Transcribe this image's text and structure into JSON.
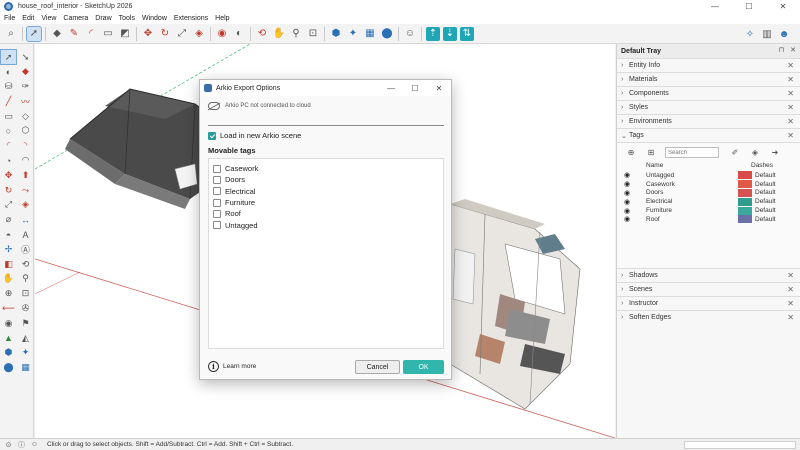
{
  "window": {
    "title": "house_roof_interior - SketchUp 2026"
  },
  "menu": [
    "File",
    "Edit",
    "View",
    "Camera",
    "Draw",
    "Tools",
    "Window",
    "Extensions",
    "Help"
  ],
  "dialog": {
    "title": "Arkio Export Options",
    "cloud_status": "Arkio PC not connected to cloud",
    "load_label": "Load in new Arkio scene",
    "load_checked": true,
    "section_title": "Movable tags",
    "tags": [
      "Casework",
      "Doors",
      "Electrical",
      "Furniture",
      "Roof",
      "Untagged"
    ],
    "learn_more": "Learn more",
    "cancel_label": "Cancel",
    "ok_label": "OK"
  },
  "tray": {
    "title": "Default Tray",
    "panels_top": [
      "Entity Info",
      "Materials",
      "Components",
      "Styles",
      "Environments"
    ],
    "tags_panel": {
      "label": "Tags",
      "search_placeholder": "Search",
      "col_name": "Name",
      "col_dashes": "Dashes",
      "rows": [
        {
          "name": "Untagged",
          "color": "#d94a4a",
          "dashes": "Default"
        },
        {
          "name": "Casework",
          "color": "#e05a4a",
          "dashes": "Default"
        },
        {
          "name": "Doors",
          "color": "#d45252",
          "dashes": "Default"
        },
        {
          "name": "Electrical",
          "color": "#2f9c8e",
          "dashes": "Default"
        },
        {
          "name": "Furniture",
          "color": "#3aa89c",
          "dashes": "Default"
        },
        {
          "name": "Roof",
          "color": "#6b6fa8",
          "dashes": "Default"
        }
      ]
    },
    "panels_bottom": [
      "Shadows",
      "Scenes",
      "Instructor",
      "Soften Edges"
    ]
  },
  "status": {
    "text": "Click or drag to select objects. Shift = Add/Subtract. Ctrl = Add. Shift + Ctrl = Subtract."
  },
  "colors": {
    "accent": "#30b6ad",
    "selection_blue": "#cfe2f5"
  }
}
